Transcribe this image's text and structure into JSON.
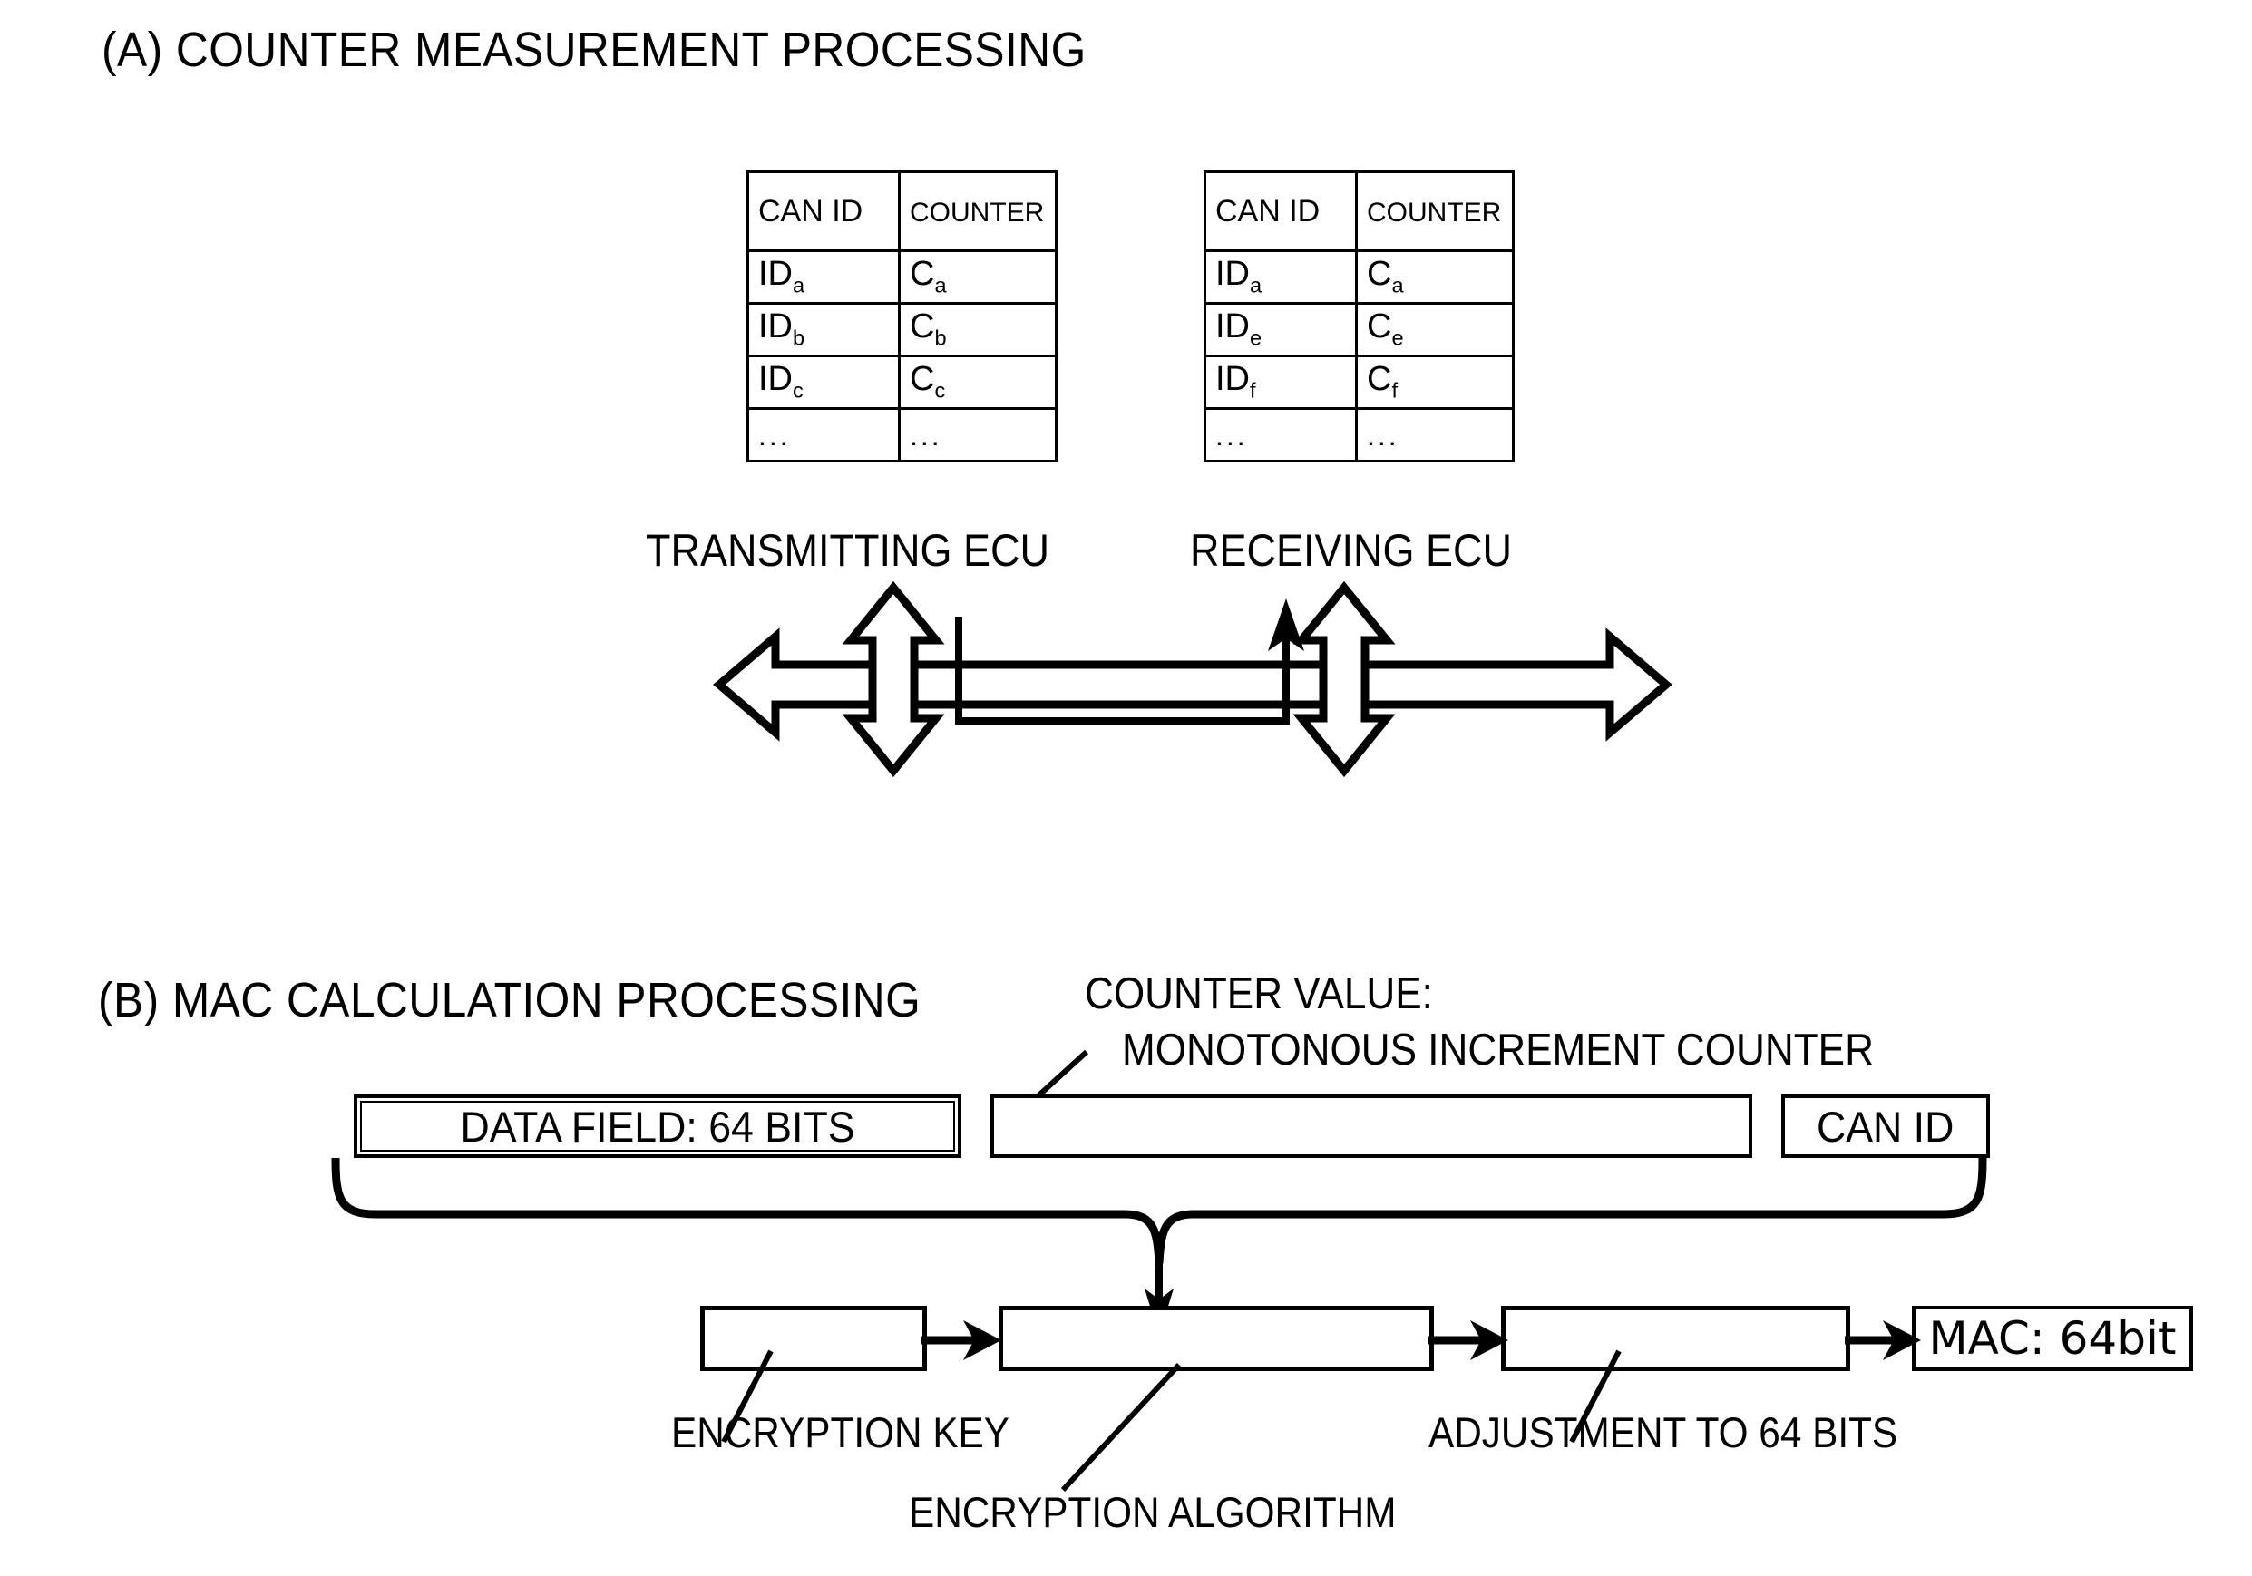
{
  "figure": {
    "sections": [
      {
        "key": "a",
        "title": "(A) COUNTER MEASUREMENT PROCESSING"
      },
      {
        "key": "b",
        "title": "(B) MAC CALCULATION PROCESSING"
      }
    ]
  },
  "part_a": {
    "tables": [
      {
        "name": "transmitting-ecu-counter-table",
        "headers": [
          "CAN ID",
          "COUNTER"
        ],
        "rows": [
          {
            "id": "ID",
            "id_sub": "a",
            "counter": "C",
            "counter_sub": "a"
          },
          {
            "id": "ID",
            "id_sub": "b",
            "counter": "C",
            "counter_sub": "b"
          },
          {
            "id": "ID",
            "id_sub": "c",
            "counter": "C",
            "counter_sub": "c"
          },
          {
            "id": "...",
            "id_sub": "",
            "counter": "...",
            "counter_sub": ""
          }
        ],
        "caption": "TRANSMITTING ECU"
      },
      {
        "name": "receiving-ecu-counter-table",
        "headers": [
          "CAN ID",
          "COUNTER"
        ],
        "rows": [
          {
            "id": "ID",
            "id_sub": "a",
            "counter": "C",
            "counter_sub": "a"
          },
          {
            "id": "ID",
            "id_sub": "e",
            "counter": "C",
            "counter_sub": "e"
          },
          {
            "id": "ID",
            "id_sub": "f",
            "counter": "C",
            "counter_sub": "f"
          },
          {
            "id": "...",
            "id_sub": "",
            "counter": "...",
            "counter_sub": ""
          }
        ],
        "caption": "RECEIVING ECU"
      }
    ],
    "bus": {
      "name": "can-bus-double-arrow",
      "style": "hollow-double-headed-horizontal-arrow"
    },
    "connectors": [
      {
        "name": "transmitting-ecu-bus-link",
        "style": "hollow-double-headed-vertical-arrow"
      },
      {
        "name": "receiving-ecu-bus-link",
        "style": "hollow-double-headed-vertical-arrow"
      }
    ],
    "message_flow": {
      "name": "message-flow-arrow",
      "style": "solid-arrow-up"
    }
  },
  "part_b": {
    "counter_note": {
      "line1": "COUNTER VALUE:",
      "line2": "MONOTONOUS INCREMENT COUNTER"
    },
    "input_fields": [
      {
        "name": "data-field-box",
        "label": "DATA FIELD: 64 BITS",
        "double_border": true
      },
      {
        "name": "counter-value-box",
        "label": "",
        "double_border": false
      },
      {
        "name": "can-id-box",
        "label": "CAN ID",
        "double_border": false
      }
    ],
    "pipeline": [
      {
        "name": "encryption-key-box",
        "label": ""
      },
      {
        "name": "encryption-algorithm-box",
        "label": ""
      },
      {
        "name": "adjustment-box",
        "label": ""
      }
    ],
    "output": {
      "name": "mac-output-box",
      "label": "MAC: 64bit"
    },
    "callouts": [
      {
        "name": "encryption-key-label",
        "text": "ENCRYPTION KEY"
      },
      {
        "name": "encryption-algorithm-label",
        "text": "ENCRYPTION ALGORITHM"
      },
      {
        "name": "adjustment-label",
        "text": "ADJUSTMENT TO 64 BITS"
      }
    ],
    "brace": {
      "name": "concatenation-brace",
      "style": "horizontal-curly-brace-down"
    }
  },
  "colors": {
    "ink": "#000000",
    "paper": "#ffffff"
  }
}
